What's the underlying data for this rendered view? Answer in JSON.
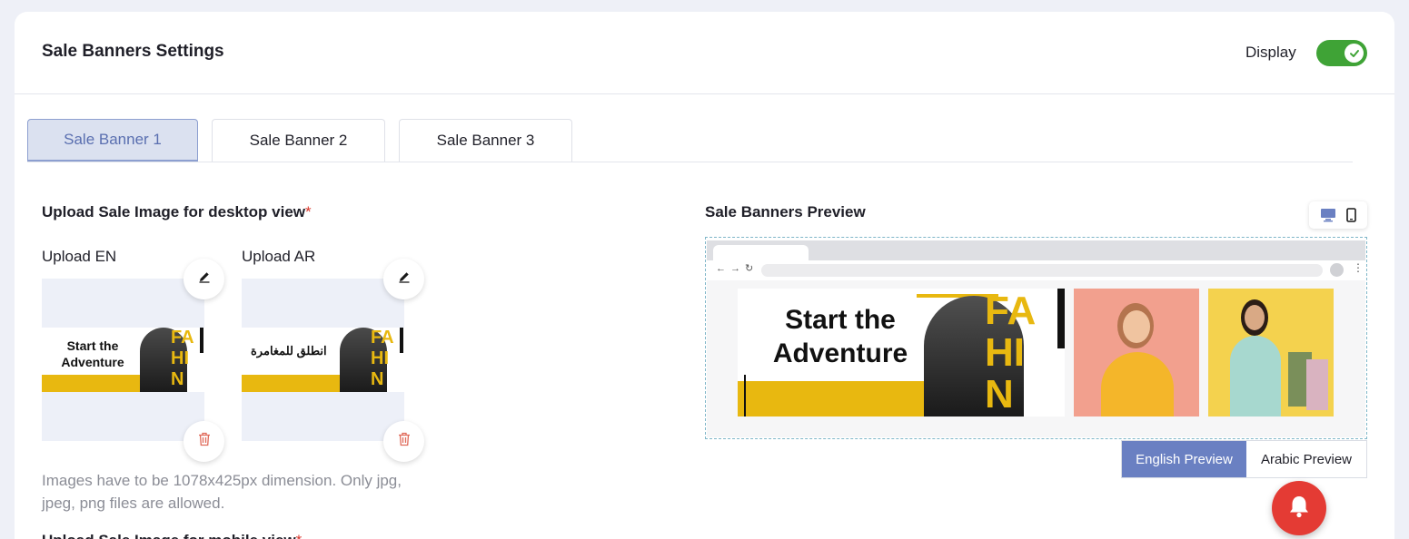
{
  "header": {
    "title": "Sale Banners Settings",
    "display_label": "Display",
    "display_on": true
  },
  "tabs": [
    {
      "label": "Sale Banner 1",
      "active": true
    },
    {
      "label": "Sale Banner 2",
      "active": false
    },
    {
      "label": "Sale Banner 3",
      "active": false
    }
  ],
  "upload": {
    "desktop_title": "Upload Sale Image for desktop view",
    "required_mark": "*",
    "en_label": "Upload EN",
    "ar_label": "Upload AR",
    "en_banner_text": "Start the Adventure",
    "ar_banner_text": "انطلق للمغامرة",
    "banner_brand_letters": "FA\nHI\nN",
    "hint": "Images have to be 1078x425px dimension. Only jpg, jpeg, png files are allowed.",
    "mobile_title_cut": "Upload Sale Image for mobile view"
  },
  "preview": {
    "title": "Sale Banners Preview",
    "banner_text": "Start the Adventure",
    "brand_letters": "FA\nHI\nN",
    "english_btn": "English Preview",
    "arabic_btn": "Arabic Preview",
    "active_lang": "English Preview"
  },
  "icons": {
    "edit": "pencil-icon",
    "delete": "trash-icon",
    "desktop": "monitor-icon",
    "mobile": "phone-icon",
    "notification": "bell-icon",
    "toggle": "check-icon"
  },
  "colors": {
    "toggle_on": "#3fa336",
    "active_tab_bg": "#dbe1f0",
    "active_preview_btn": "#6a80c2",
    "delete_icon": "#e06a5a",
    "banner_yellow": "#e8b810",
    "notification_bell": "#e43b34"
  }
}
